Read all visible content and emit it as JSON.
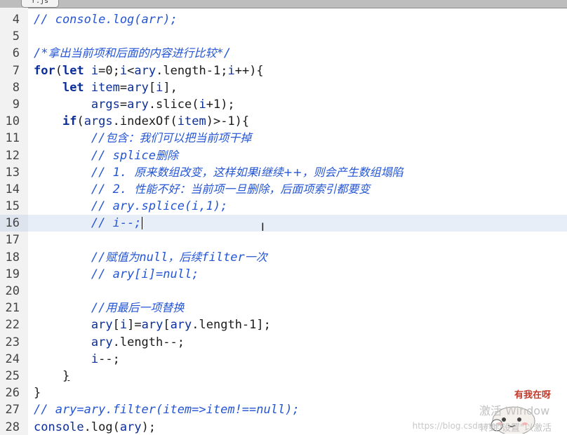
{
  "tab": {
    "title": "r.js"
  },
  "editor": {
    "active_line": 16,
    "lines": [
      {
        "n": "4",
        "html": "<span class=\"cm\">// console.log(arr);</span>"
      },
      {
        "n": "5",
        "html": ""
      },
      {
        "n": "6",
        "html": "<span class=\"cm\">/*</span><span class=\"cm-zh\">拿出当前项和后面的内容进行比较</span><span class=\"cm\">*/</span>"
      },
      {
        "n": "7",
        "html": "<span class=\"kw\">for</span><span class=\"txt\">(</span><span class=\"kw\">let</span><span class=\"id\"> i</span><span class=\"txt\">=0;</span><span class=\"id\">i</span><span class=\"txt\">&lt;</span><span class=\"id\">ary</span><span class=\"txt\">.length-1;</span><span class=\"id\">i</span><span class=\"txt\">++){</span>"
      },
      {
        "n": "8",
        "html": "    <span class=\"kw\">let</span><span class=\"id\"> item</span><span class=\"txt\">=</span><span class=\"id\">ary</span><span class=\"txt\">[</span><span class=\"id\">i</span><span class=\"txt\">],</span>"
      },
      {
        "n": "9",
        "html": "        <span class=\"id\">args</span><span class=\"txt\">=</span><span class=\"id\">ary</span><span class=\"txt\">.slice(</span><span class=\"id\">i</span><span class=\"txt\">+1);</span>"
      },
      {
        "n": "10",
        "html": "    <span class=\"kw\">if</span><span class=\"txt\">(</span><span class=\"id\">args</span><span class=\"txt\">.indexOf(</span><span class=\"id\">item</span><span class=\"txt\">)&gt;-1){</span>"
      },
      {
        "n": "11",
        "html": "        <span class=\"cm\">//</span><span class=\"cm-zh\">包含：我们可以把当前项干掉</span>"
      },
      {
        "n": "12",
        "html": "        <span class=\"cm\">// splice</span><span class=\"cm-zh\">删除</span>"
      },
      {
        "n": "13",
        "html": "        <span class=\"cm\">// 1. </span><span class=\"cm-zh\">原来数组改变，这样如果i继续++，则会产生数组塌陷</span>"
      },
      {
        "n": "14",
        "html": "        <span class=\"cm\">// 2. </span><span class=\"cm-zh\">性能不好：当前项一旦删除，后面项索引都要变</span>"
      },
      {
        "n": "15",
        "html": "        <span class=\"cm\">// ary.splice(i,1);</span>"
      },
      {
        "n": "16",
        "html": "        <span class=\"cm\">// i--;</span><span class=\"caret\"></span>"
      },
      {
        "n": "17",
        "html": ""
      },
      {
        "n": "18",
        "html": "        <span class=\"cm\">//</span><span class=\"cm-zh\">赋值为</span><span class=\"cm\">null</span><span class=\"cm-zh\">，后续</span><span class=\"cm\">filter</span><span class=\"cm-zh\">一次</span>"
      },
      {
        "n": "19",
        "html": "        <span class=\"cm\">// ary[i]=null;</span>"
      },
      {
        "n": "20",
        "html": ""
      },
      {
        "n": "21",
        "html": "        <span class=\"cm\">//</span><span class=\"cm-zh\">用最后一项替换</span>"
      },
      {
        "n": "22",
        "html": "        <span class=\"id\">ary</span><span class=\"txt\">[</span><span class=\"id\">i</span><span class=\"txt\">]=</span><span class=\"id\">ary</span><span class=\"txt\">[</span><span class=\"id\">ary</span><span class=\"txt\">.length-1];</span>"
      },
      {
        "n": "23",
        "html": "        <span class=\"id\">ary</span><span class=\"txt\">.length--;</span>"
      },
      {
        "n": "24",
        "html": "        <span class=\"id\">i</span><span class=\"txt\">--;</span>"
      },
      {
        "n": "25",
        "html": "    <span class=\"txt brace-ul\">}</span>"
      },
      {
        "n": "26",
        "html": "<span class=\"txt\">}</span>"
      },
      {
        "n": "27",
        "html": "<span class=\"cm\">// ary=ary.filter(item=&gt;item!==null);</span>"
      },
      {
        "n": "28",
        "html": "<span class=\"id\">console</span><span class=\"txt\">.log(</span><span class=\"id\">ary</span><span class=\"txt\">);</span>"
      }
    ]
  },
  "overlay": {
    "sticker_text": "有我在呀",
    "activate_title": "激活 Window",
    "activate_sub": "转到\"设置\"以激活",
    "url": "https://blog.csdn.net/"
  }
}
